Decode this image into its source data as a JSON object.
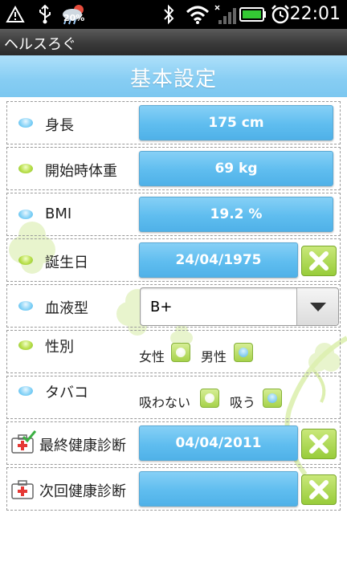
{
  "status_bar": {
    "battery_percent": "20%",
    "time": "22:01",
    "icons": [
      "warning-icon",
      "usb-icon",
      "weather-icon",
      "bluetooth-icon",
      "wifi-icon",
      "signal-icon",
      "battery-icon",
      "alarm-icon"
    ]
  },
  "app": {
    "title": "ヘルスろぐ"
  },
  "header": {
    "title": "基本設定"
  },
  "rows": {
    "height": {
      "label": "身長",
      "value": "175 cm"
    },
    "start_weight": {
      "label": "開始時体重",
      "value": "69 kg"
    },
    "bmi": {
      "label": "BMI",
      "value": "19.2 %"
    },
    "birthday": {
      "label": "誕生日",
      "value": "24/04/1975"
    },
    "blood_type": {
      "label": "血液型",
      "value": "B+"
    },
    "gender": {
      "label": "性別",
      "option_female": "女性",
      "option_male": "男性",
      "selected": "男性"
    },
    "tobacco": {
      "label": "タバコ",
      "option_no": "吸わない",
      "option_yes": "吸う",
      "selected": "吸う"
    },
    "last_checkup": {
      "label": "最終健康診断",
      "value": "04/04/2011"
    },
    "next_checkup": {
      "label": "次回健康診断",
      "value": ""
    }
  },
  "colors": {
    "accent_blue": "#5fbdef",
    "accent_green": "#a6d24a",
    "header_blue": "#86cdf3"
  }
}
